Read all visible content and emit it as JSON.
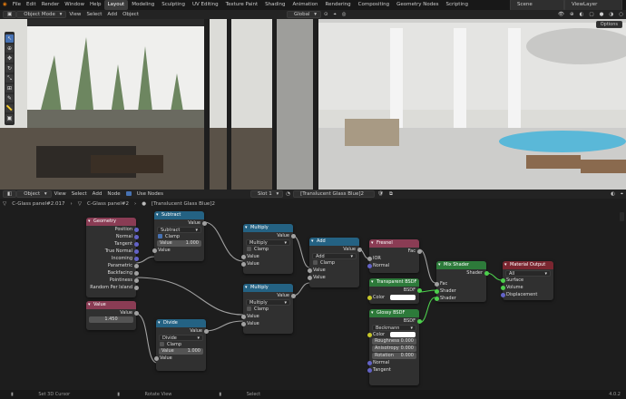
{
  "topbar": {
    "menus": [
      "File",
      "Edit",
      "Render",
      "Window",
      "Help"
    ],
    "workspaces": [
      "Layout",
      "Modeling",
      "Sculpting",
      "UV Editing",
      "Texture Paint",
      "Shading",
      "Animation",
      "Rendering",
      "Compositing",
      "Geometry Nodes",
      "Scripting"
    ],
    "scene": "Scene",
    "view_layer": "ViewLayer"
  },
  "view3d": {
    "mode": "Object Mode",
    "menus": [
      "View",
      "Select",
      "Add",
      "Object"
    ],
    "orientation": "Global",
    "options": "Options"
  },
  "node_editor": {
    "object_label": "Object",
    "menus": [
      "View",
      "Select",
      "Add",
      "Node"
    ],
    "use_nodes": "Use Nodes",
    "slot": "Slot 1",
    "material": "[Translucent Glass Blue]2"
  },
  "breadcrumb": [
    "C-Glass panel#2.017",
    "C-Glass panel#2",
    "[Translucent Glass Blue]2"
  ],
  "nodes": {
    "geometry": {
      "title": "Geometry",
      "color": "#8a3c54",
      "outputs": [
        "Position",
        "Normal",
        "Tangent",
        "True Normal",
        "Incoming",
        "Parametric",
        "Backfacing",
        "Pointiness",
        "Random Per Island"
      ]
    },
    "value": {
      "title": "Value",
      "color": "#8a3c54",
      "out": "Value",
      "val": "1.450"
    },
    "subtract": {
      "title": "Subtract",
      "color": "#246283",
      "out": "Value",
      "op": "Subtract",
      "clamp": "Clamp",
      "field_label": "Value",
      "field_val": "1.000",
      "in": "Value"
    },
    "divide": {
      "title": "Divide",
      "color": "#246283",
      "out": "Value",
      "op": "Divide",
      "clamp": "Clamp",
      "field_label": "Value",
      "field_val": "1.000",
      "in": "Value"
    },
    "multiply1": {
      "title": "Multiply",
      "color": "#246283",
      "out": "Value",
      "op": "Multiply",
      "clamp": "Clamp",
      "in1": "Value",
      "in2": "Value"
    },
    "multiply2": {
      "title": "Multiply",
      "color": "#246283",
      "out": "Value",
      "op": "Multiply",
      "clamp": "Clamp",
      "in1": "Value",
      "in2": "Value"
    },
    "add": {
      "title": "Add",
      "color": "#246283",
      "out": "Value",
      "op": "Add",
      "clamp": "Clamp",
      "in1": "Value",
      "in2": "Value"
    },
    "fresnel": {
      "title": "Fresnel",
      "color": "#8a3c54",
      "out": "Fac",
      "ior": "IOR",
      "normal": "Normal"
    },
    "transparent": {
      "title": "Transparent BSDF",
      "color": "#2d7a3a",
      "out": "BSDF",
      "color_label": "Color"
    },
    "glossy": {
      "title": "Glossy BSDF",
      "color": "#2d7a3a",
      "out": "BSDF",
      "dist": "Beckmann",
      "color_label": "Color",
      "roughness": "Roughness",
      "roughness_val": "0.000",
      "anisotropy": "Anisotropy",
      "anisotropy_val": "0.000",
      "rotation": "Rotation",
      "rotation_val": "0.000",
      "normal": "Normal",
      "tangent": "Tangent"
    },
    "mix": {
      "title": "Mix Shader",
      "color": "#2d7a3a",
      "out": "Shader",
      "fac": "Fac",
      "in1": "Shader",
      "in2": "Shader"
    },
    "output": {
      "title": "Material Output",
      "color": "#7a2630",
      "target": "All",
      "surface": "Surface",
      "volume": "Volume",
      "displacement": "Displacement"
    }
  },
  "status": {
    "left": "Set 3D Cursor",
    "mid": "Rotate View",
    "right": "Select",
    "version": "4.0.2"
  }
}
